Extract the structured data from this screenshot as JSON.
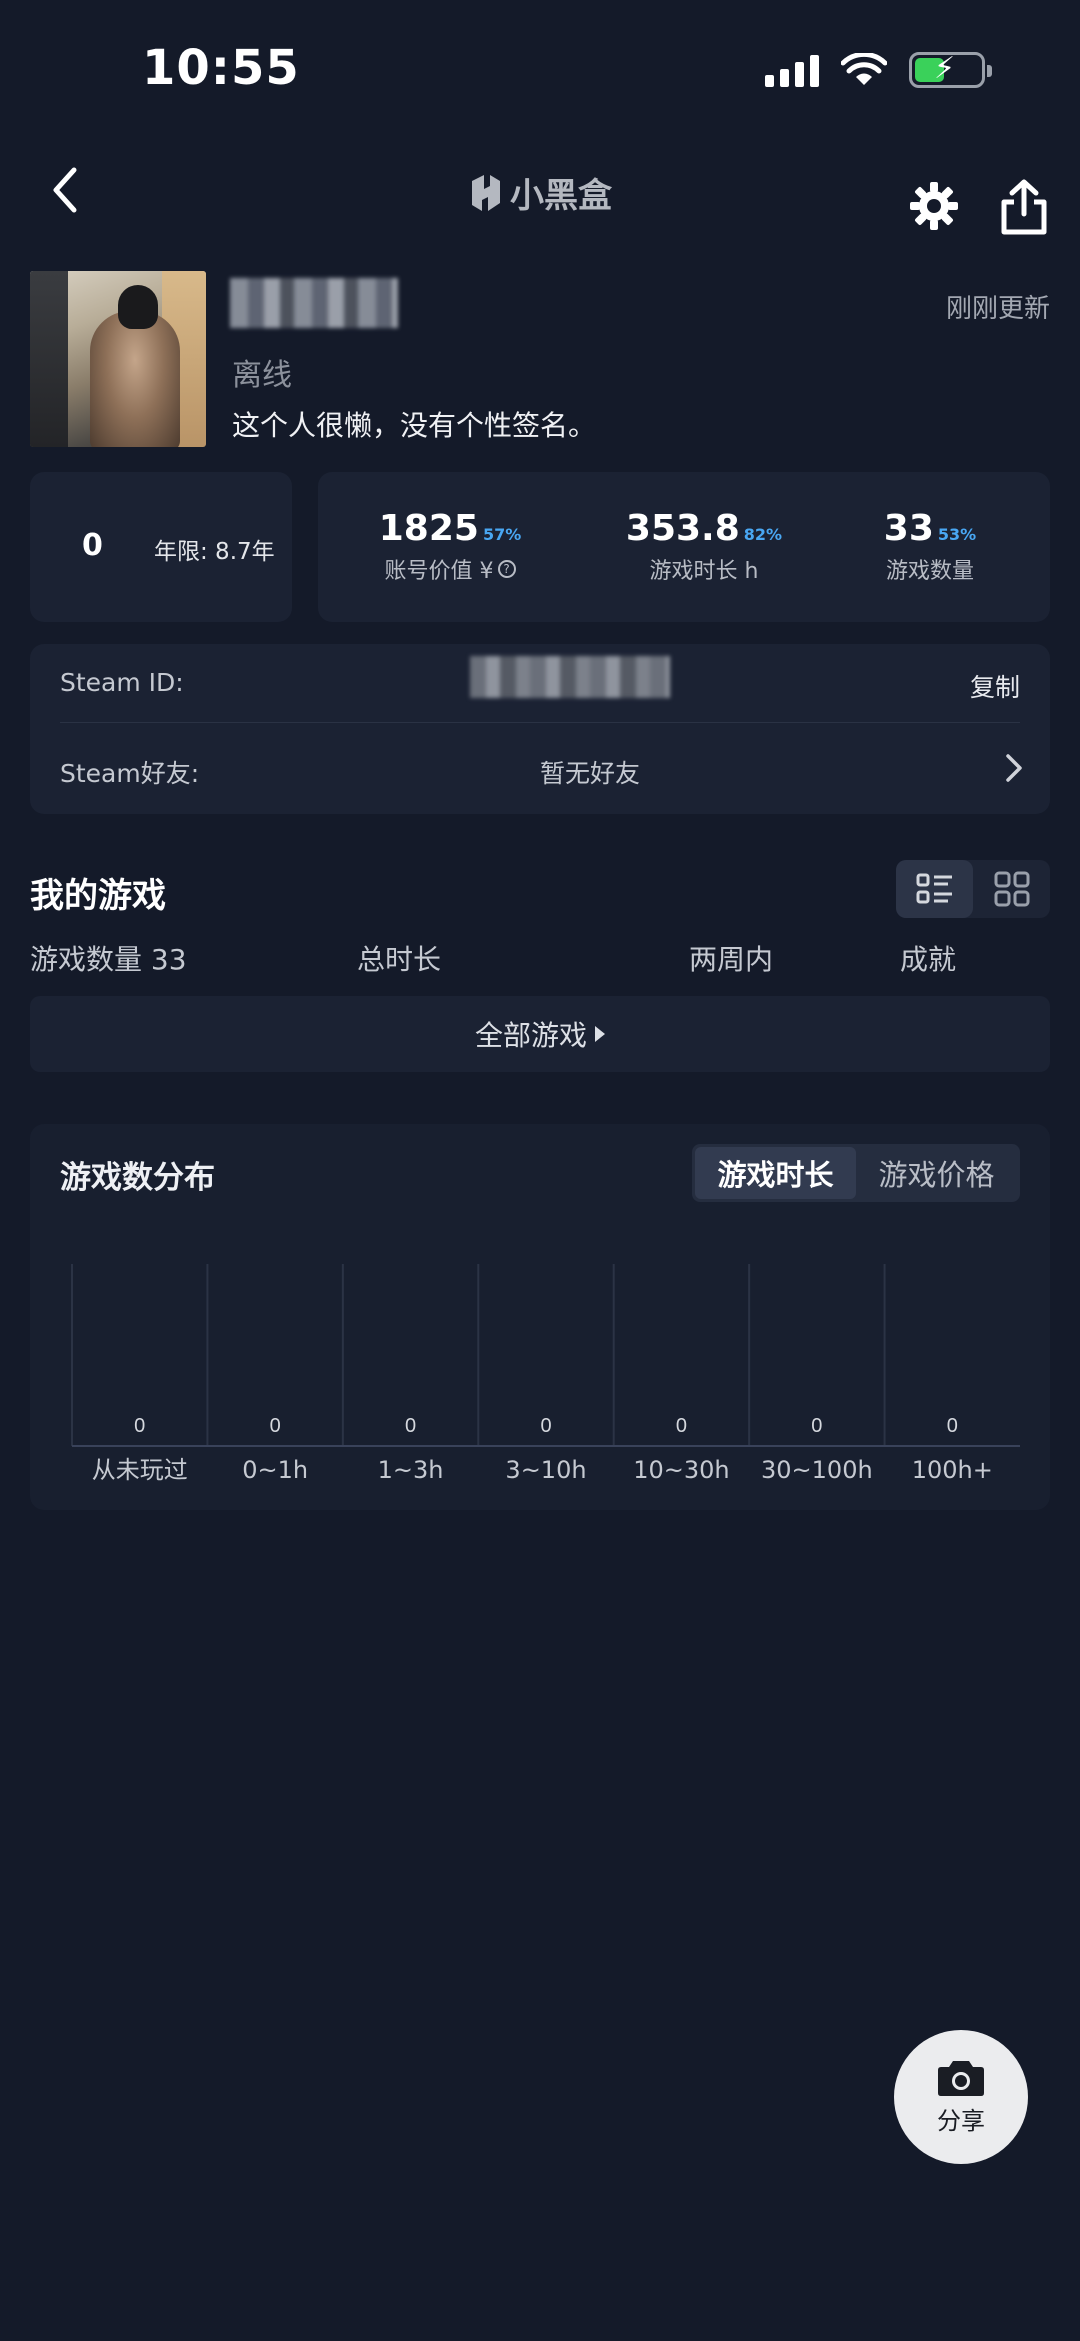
{
  "status_bar": {
    "time": "10:55"
  },
  "nav": {
    "app_name": "小黑盒"
  },
  "profile": {
    "online_status": "离线",
    "signature": "这个人很懒，没有个性签名。",
    "updated": "刚刚更新"
  },
  "level": {
    "value": "0",
    "years": "年限: 8.7年"
  },
  "stats": [
    {
      "value": "1825",
      "pct": "57%",
      "label": "账号价值 ¥"
    },
    {
      "value": "353.8",
      "pct": "82%",
      "label": "游戏时长 h"
    },
    {
      "value": "33",
      "pct": "53%",
      "label": "游戏数量"
    }
  ],
  "steam": {
    "id_label": "Steam ID:",
    "copy_label": "复制",
    "friends_label": "Steam好友:",
    "friends_value": "暂无好友"
  },
  "my_games": {
    "title": "我的游戏",
    "columns": [
      "游戏数量 33",
      "总时长",
      "两周内",
      "成就"
    ],
    "filter_label": "全部游戏"
  },
  "distribution": {
    "title": "游戏数分布",
    "tabs": [
      "游戏时长",
      "游戏价格"
    ],
    "active_tab": 0
  },
  "chart_data": {
    "type": "bar",
    "categories": [
      "从未玩过",
      "0~1h",
      "1~3h",
      "3~10h",
      "10~30h",
      "30~100h",
      "100h+"
    ],
    "values": [
      0,
      0,
      0,
      0,
      0,
      0,
      0
    ],
    "title": "游戏数分布",
    "xlabel": "",
    "ylabel": "",
    "grid": true
  },
  "fab": {
    "label": "分享"
  },
  "colors": {
    "background": "#141a29",
    "card": "#1b2233",
    "accent_pct": "#49a7f3",
    "battery": "#3ad15a"
  }
}
